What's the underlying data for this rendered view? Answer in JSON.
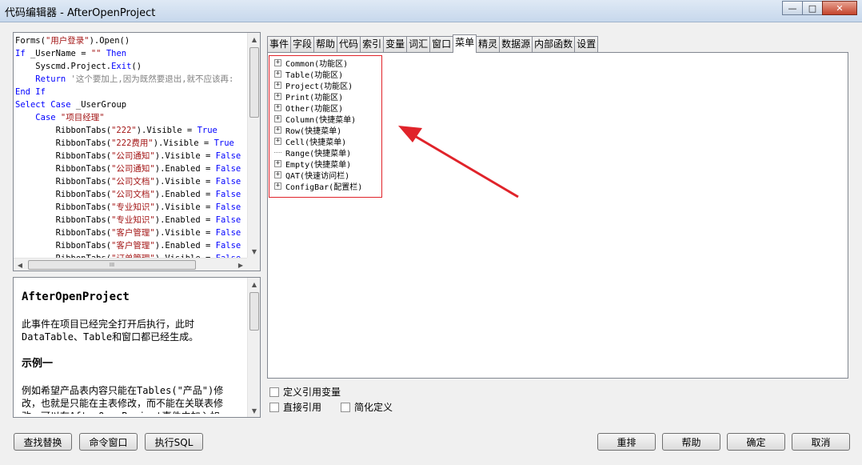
{
  "window": {
    "title": "代码编辑器 - AfterOpenProject",
    "minimize": "—",
    "maximize": "□",
    "close": "✕"
  },
  "code_lines": [
    [
      {
        "t": "Forms("
      },
      {
        "t": "\"用户登录\"",
        "c": "str"
      },
      {
        "t": ").Open()"
      }
    ],
    [
      {
        "t": "If",
        "c": "kw"
      },
      {
        "t": " _UserName = "
      },
      {
        "t": "\"\"",
        "c": "str"
      },
      {
        "t": " "
      },
      {
        "t": "Then",
        "c": "kw"
      }
    ],
    [
      {
        "t": "    Syscmd.Project."
      },
      {
        "t": "Exit",
        "c": "kw"
      },
      {
        "t": "()"
      }
    ],
    [
      {
        "t": "    "
      },
      {
        "t": "Return",
        "c": "kw"
      },
      {
        "t": " '这个要加上,因为既然要退出,就不应该再:",
        "c": "cm"
      }
    ],
    [
      {
        "t": "End If",
        "c": "kw"
      }
    ],
    [
      {
        "t": "Select Case",
        "c": "kw"
      },
      {
        "t": " _UserGroup"
      }
    ],
    [
      {
        "t": "    "
      },
      {
        "t": "Case",
        "c": "kw"
      },
      {
        "t": " "
      },
      {
        "t": "\"项目经理\"",
        "c": "str"
      }
    ],
    [
      {
        "t": "        RibbonTabs("
      },
      {
        "t": "\"222\"",
        "c": "str"
      },
      {
        "t": ").Visible = "
      },
      {
        "t": "True",
        "c": "kw"
      }
    ],
    [
      {
        "t": "        RibbonTabs("
      },
      {
        "t": "\"222费用\"",
        "c": "str"
      },
      {
        "t": ").Visible = "
      },
      {
        "t": "True",
        "c": "kw"
      }
    ],
    [
      {
        "t": "        RibbonTabs("
      },
      {
        "t": "\"公司通知\"",
        "c": "str"
      },
      {
        "t": ").Visible = "
      },
      {
        "t": "False",
        "c": "kw"
      }
    ],
    [
      {
        "t": "        RibbonTabs("
      },
      {
        "t": "\"公司通知\"",
        "c": "str"
      },
      {
        "t": ").Enabled = "
      },
      {
        "t": "False",
        "c": "kw"
      }
    ],
    [
      {
        "t": "        RibbonTabs("
      },
      {
        "t": "\"公司文档\"",
        "c": "str"
      },
      {
        "t": ").Visible = "
      },
      {
        "t": "False",
        "c": "kw"
      }
    ],
    [
      {
        "t": "        RibbonTabs("
      },
      {
        "t": "\"公司文档\"",
        "c": "str"
      },
      {
        "t": ").Enabled = "
      },
      {
        "t": "False",
        "c": "kw"
      }
    ],
    [
      {
        "t": "        RibbonTabs("
      },
      {
        "t": "\"专业知识\"",
        "c": "str"
      },
      {
        "t": ").Visible = "
      },
      {
        "t": "False",
        "c": "kw"
      }
    ],
    [
      {
        "t": "        RibbonTabs("
      },
      {
        "t": "\"专业知识\"",
        "c": "str"
      },
      {
        "t": ").Enabled = "
      },
      {
        "t": "False",
        "c": "kw"
      }
    ],
    [
      {
        "t": "        RibbonTabs("
      },
      {
        "t": "\"客户管理\"",
        "c": "str"
      },
      {
        "t": ").Visible = "
      },
      {
        "t": "False",
        "c": "kw"
      }
    ],
    [
      {
        "t": "        RibbonTabs("
      },
      {
        "t": "\"客户管理\"",
        "c": "str"
      },
      {
        "t": ").Enabled = "
      },
      {
        "t": "False",
        "c": "kw"
      }
    ],
    [
      {
        "t": "        RibbonTabs("
      },
      {
        "t": "\"订单管理\"",
        "c": "str"
      },
      {
        "t": ").Visible = "
      },
      {
        "t": "False",
        "c": "kw"
      }
    ]
  ],
  "scroll": {
    "up": "▲",
    "down": "▼",
    "left": "◀",
    "right": "▶",
    "grip": "III"
  },
  "help": {
    "title": "AfterOpenProject",
    "desc": "此事件在项目已经完全打开后执行，此时DataTable、Table和窗口都已经生成。",
    "example_title": "示例一",
    "example_text": "例如希望产品表内容只能在Tables(\"产品\")修改，也就是只能在主表修改，而不能在关联表修改，可以在AfterOpenProject事件中加入如"
  },
  "tabs": [
    "事件",
    "字段",
    "帮助",
    "代码",
    "索引",
    "变量",
    "词汇",
    "窗口",
    "菜单",
    "精灵",
    "数据源",
    "内部函数",
    "设置"
  ],
  "active_tab": "菜单",
  "tree": [
    {
      "label": "Common(功能区)",
      "expand": "+"
    },
    {
      "label": "Table(功能区)",
      "expand": "+"
    },
    {
      "label": "Project(功能区)",
      "expand": "+"
    },
    {
      "label": "Print(功能区)",
      "expand": "+"
    },
    {
      "label": "Other(功能区)",
      "expand": "+"
    },
    {
      "label": "Column(快捷菜单)",
      "expand": "+"
    },
    {
      "label": "Row(快捷菜单)",
      "expand": "+"
    },
    {
      "label": "Cell(快捷菜单)",
      "expand": "+"
    },
    {
      "label": "Range(快捷菜单)",
      "expand": ""
    },
    {
      "label": "Empty(快捷菜单)",
      "expand": "+"
    },
    {
      "label": "QAT(快速访问栏)",
      "expand": "+"
    },
    {
      "label": "ConfigBar(配置栏)",
      "expand": "+"
    }
  ],
  "options": {
    "define_ref_var": "定义引用变量",
    "direct_ref": "直接引用",
    "simplified_def": "简化定义"
  },
  "buttons": {
    "find_replace": "查找替换",
    "command_window": "命令窗口",
    "exec_sql": "执行SQL",
    "rearrange": "重排",
    "help": "帮助",
    "ok": "确定",
    "cancel": "取消"
  },
  "colors": {
    "keyword": "#0000ff",
    "string": "#a31515",
    "comment": "#808080",
    "highlight_box": "#e0232a"
  }
}
